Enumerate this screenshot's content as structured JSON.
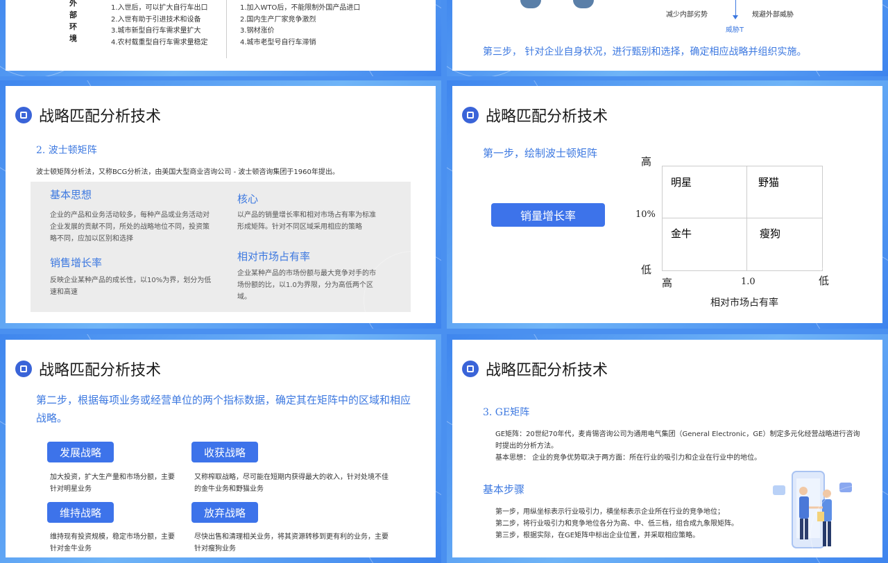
{
  "slide_tl": {
    "env_label": "外部环境",
    "opportunities": [
      "1.入世后，可以扩大自行车出口",
      "2.入世有助于引进技术和设备",
      "3.城市新型自行车需求量扩大",
      "4.农村载重型自行车需求量稳定"
    ],
    "threats": [
      "1.加入WTO后，不能限制外国产品进口",
      "2.国内生产厂家竞争激烈",
      "3.钢材涨价",
      "4.城市老型号自行车滞销"
    ]
  },
  "slide_tr": {
    "reduce_internal": "减少内部劣势",
    "avoid_external": "规避外部威胁",
    "threat_label": "威胁T",
    "step3": "第三步， 针对企业自身状况，进行甄别和选择，确定相应战略并组织实施。"
  },
  "common": {
    "title": "战略匹配分析技术"
  },
  "slide_ml": {
    "heading": "2. 波士顿矩阵",
    "intro": "波士顿矩阵分析法，又称BCG分析法，由美国大型商业咨询公司 - 波士顿咨询集团于1960年提出。",
    "basic_title": "基本思想",
    "basic_text": "企业的产品和业务活动较多，每种产品或业务活动对企业发展的贡献不同，所处的战略地位不同，投资策略不同，应加以区别和选择",
    "core_title": "核心",
    "core_text": "以产品的销量增长率和相对市场占有率为标准形成矩阵。针对不同区域采用相应的策略",
    "growth_title": "销售增长率",
    "growth_text": "反映企业某种产品的成长性，以10%为界，划分为低速和高速",
    "share_title": "相对市场占有率",
    "share_text": "企业某种产品的市场份额与最大竞争对手的市场份额的比，以1.0为界限，分为高低两个区域。"
  },
  "slide_mr": {
    "step1": "第一步，绘制波士顿矩阵",
    "growth_btn": "销量增长率",
    "high": "高",
    "low": "低",
    "ten_pct": "10%",
    "x_high": "高",
    "x_mid": "1.0",
    "x_low": "低",
    "x_label": "相对市场占有率",
    "cells": [
      "明星",
      "野猫",
      "金牛",
      "瘦狗"
    ]
  },
  "slide_bl": {
    "step2": "第二步，根据每项业务或经营单位的两个指标数据，确定其在矩阵中的区域和相应战略。",
    "strategies": [
      {
        "name": "发展战略",
        "desc": "加大投资，扩大生产量和市场分额，主要针对明星业务"
      },
      {
        "name": "收获战略",
        "desc": "又称榨取战略，尽可能在短期内获得最大的收入，针对处境不佳的金牛业务和野猫业务"
      },
      {
        "name": "维持战略",
        "desc": "维持现有投资规模，稳定市场分额，主要针对金牛业务"
      },
      {
        "name": "放弃战略",
        "desc": "尽快出售和清理相关业务，将其资源转移到更有利的业务，主要针对瘦狗业务"
      }
    ]
  },
  "slide_br": {
    "heading": "3. GE矩阵",
    "ge_text": "GE矩阵：20世纪70年代，麦肯锡咨询公司为通用电气集团（General Electronic，GE）制定多元化经营战略进行咨询时提出的分析方法。",
    "basic_text": "基本思想： 企业的竞争优势取决于两方面：所在行业的吸引力和企业在行业中的地位。",
    "steps_title": "基本步骤",
    "steps": [
      "第一步，用纵坐标表示行业吸引力，横坐标表示企业所在行业的竞争地位；",
      "第二步，将行业吸引力和竞争地位各分为高、中、低三档，组合成九象限矩阵。",
      "第三步，根据实际，在GE矩阵中标出企业位置，并采取相应策略。"
    ]
  }
}
